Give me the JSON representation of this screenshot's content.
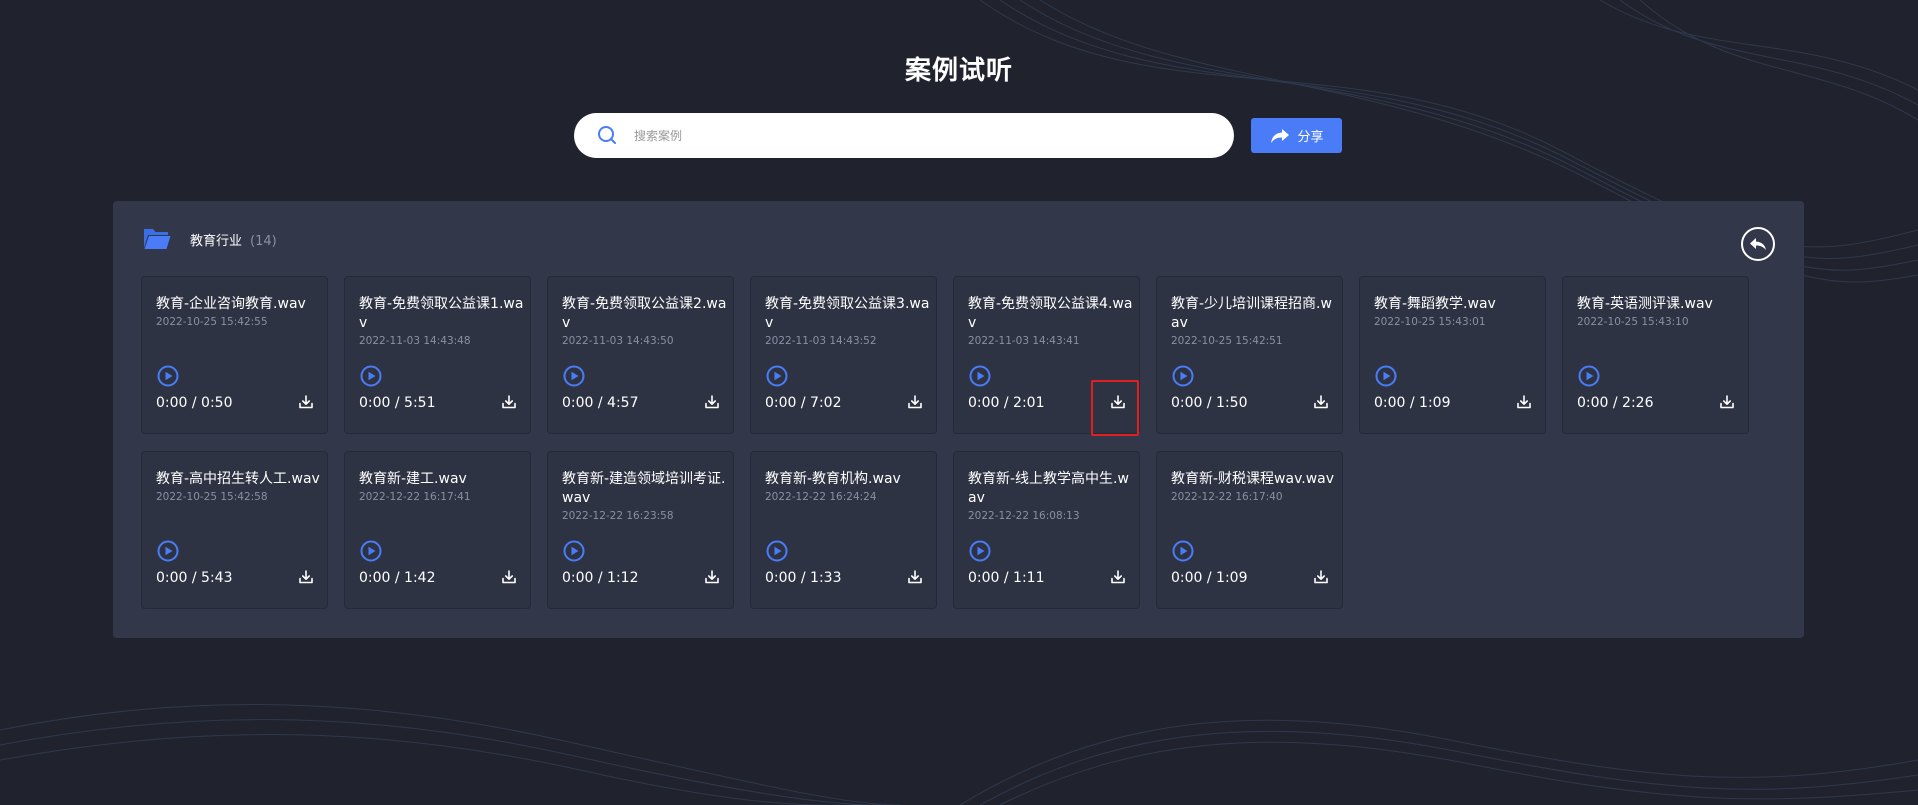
{
  "header": {
    "title": "案例试听"
  },
  "search": {
    "placeholder": "搜索案例",
    "value": ""
  },
  "toolbar": {
    "share_label": "分享"
  },
  "category": {
    "name": "教育行业",
    "count": "(14)"
  },
  "colors": {
    "accent": "#4a7cf7",
    "background": "#20232d",
    "panel": "#32374a",
    "card": "#2e3344",
    "highlight": "#e02020"
  },
  "cards": [
    {
      "title": "教育-企业咨询教育.wav",
      "date": "2022-10-25 15:42:55",
      "time": "0:00 / 0:50"
    },
    {
      "title": "教育-免费领取公益课1.wav",
      "date": "2022-11-03 14:43:48",
      "time": "0:00 / 5:51"
    },
    {
      "title": "教育-免费领取公益课2.wav",
      "date": "2022-11-03 14:43:50",
      "time": "0:00 / 4:57"
    },
    {
      "title": "教育-免费领取公益课3.wav",
      "date": "2022-11-03 14:43:52",
      "time": "0:00 / 7:02"
    },
    {
      "title": "教育-免费领取公益课4.wav",
      "date": "2022-11-03 14:43:41",
      "time": "0:00 / 2:01"
    },
    {
      "title": "教育-少儿培训课程招商.wav",
      "date": "2022-10-25 15:42:51",
      "time": "0:00 / 1:50"
    },
    {
      "title": "教育-舞蹈教学.wav",
      "date": "2022-10-25 15:43:01",
      "time": "0:00 / 1:09"
    },
    {
      "title": "教育-英语测评课.wav",
      "date": "2022-10-25 15:43:10",
      "time": "0:00 / 2:26"
    },
    {
      "title": "教育-高中招生转人工.wav",
      "date": "2022-10-25 15:42:58",
      "time": "0:00 / 5:43"
    },
    {
      "title": "教育新-建工.wav",
      "date": "2022-12-22 16:17:41",
      "time": "0:00 / 1:42"
    },
    {
      "title": "教育新-建造领域培训考证.wav",
      "date": "2022-12-22 16:23:58",
      "time": "0:00 / 1:12"
    },
    {
      "title": "教育新-教育机构.wav",
      "date": "2022-12-22 16:24:24",
      "time": "0:00 / 1:33"
    },
    {
      "title": "教育新-线上教学高中生.wav",
      "date": "2022-12-22 16:08:13",
      "time": "0:00 / 1:11"
    },
    {
      "title": "教育新-财税课程wav.wav",
      "date": "2022-12-22 16:17:40",
      "time": "0:00 / 1:09"
    }
  ]
}
